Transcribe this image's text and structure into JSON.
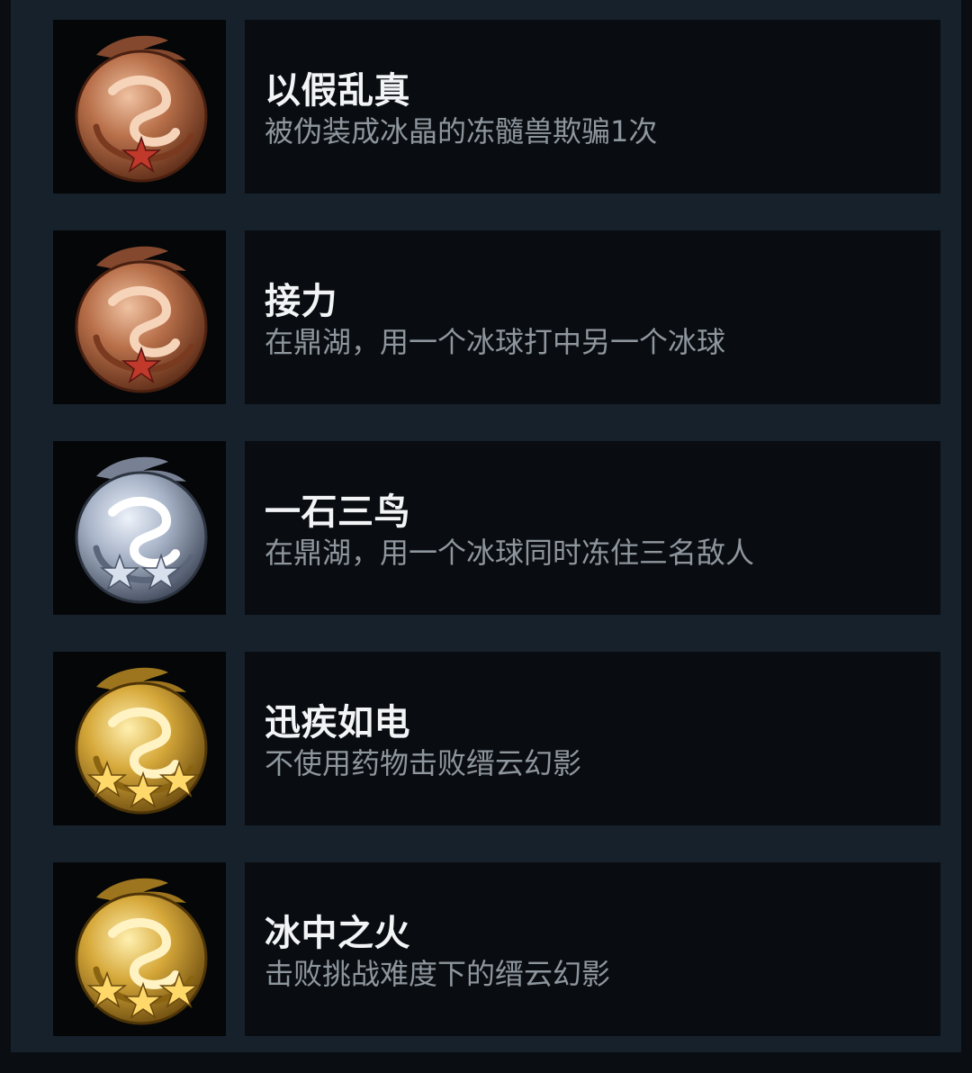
{
  "achievements": [
    {
      "title": "以假乱真",
      "description": "被伪装成冰晶的冻髓兽欺骗1次",
      "tier": "bronze",
      "stars": 1,
      "icon": "bronze-dragon-medal-icon"
    },
    {
      "title": "接力",
      "description": "在鼎湖，用一个冰球打中另一个冰球",
      "tier": "bronze",
      "stars": 1,
      "icon": "bronze-dragon-medal-icon"
    },
    {
      "title": "一石三鸟",
      "description": "在鼎湖，用一个冰球同时冻住三名敌人",
      "tier": "silver",
      "stars": 2,
      "icon": "silver-dragon-medal-icon"
    },
    {
      "title": "迅疾如电",
      "description": "不使用药物击败缙云幻影",
      "tier": "gold",
      "stars": 3,
      "icon": "gold-dragon-medal-icon"
    },
    {
      "title": "冰中之火",
      "description": "击败挑战难度下的缙云幻影",
      "tier": "gold",
      "stars": 3,
      "icon": "gold-dragon-medal-icon"
    }
  ],
  "colors": {
    "page_background": "#17212c",
    "card_background": "#090c10",
    "badge_background": "#050608",
    "title_text": "#f2f4f6",
    "description_text": "#8e969e",
    "bronze": "#b8704a",
    "silver": "#a7b3c7",
    "gold": "#d6a83a"
  }
}
